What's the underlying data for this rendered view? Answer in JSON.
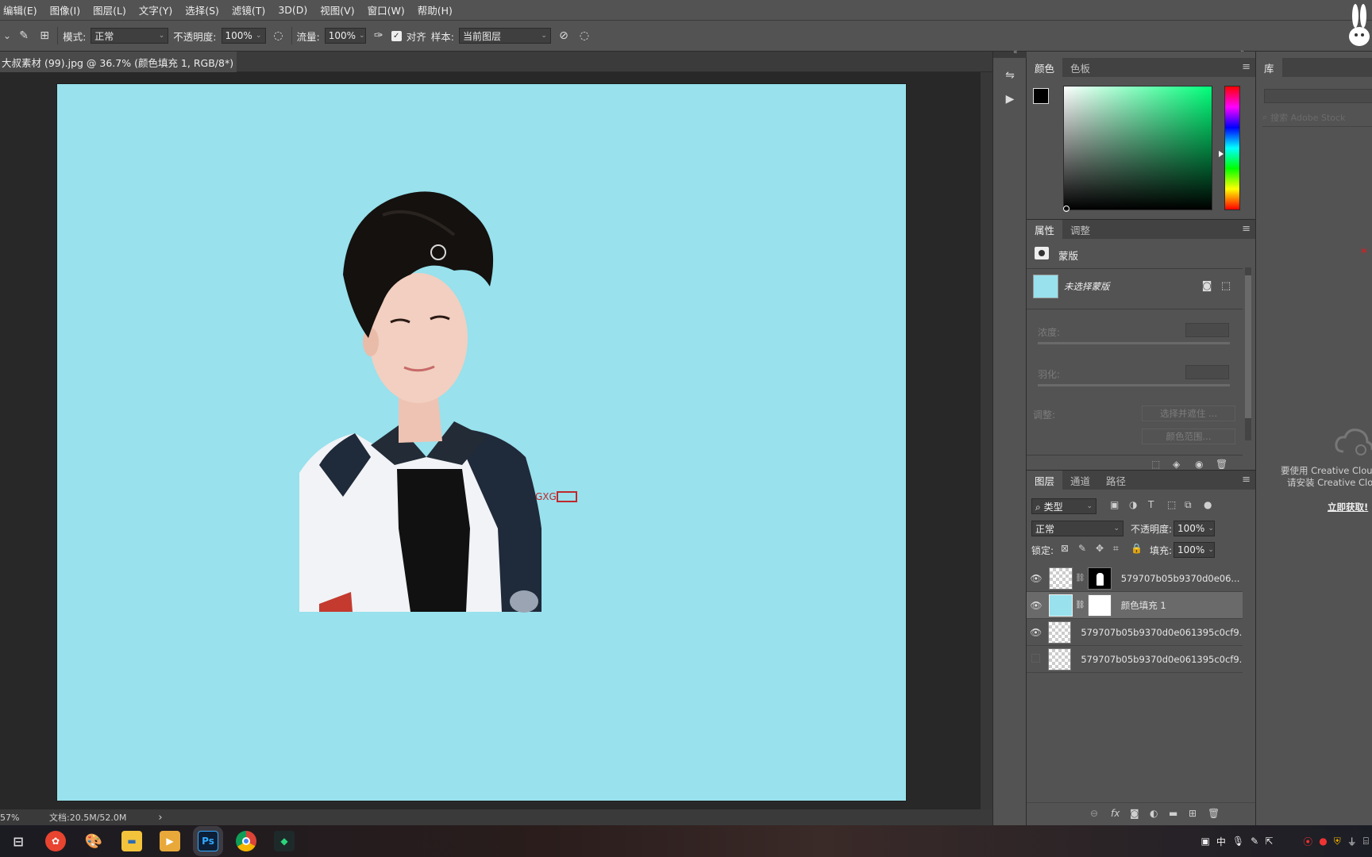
{
  "menu": [
    "编辑(E)",
    "图像(I)",
    "图层(L)",
    "文字(Y)",
    "选择(S)",
    "滤镜(T)",
    "3D(D)",
    "视图(V)",
    "窗口(W)",
    "帮助(H)"
  ],
  "options": {
    "mode_label": "模式:",
    "mode_value": "正常",
    "opacity_label": "不透明度:",
    "opacity_value": "100%",
    "flow_label": "流量:",
    "flow_value": "100%",
    "align_label": "对齐",
    "sample_label": "样本:",
    "sample_value": "当前图层"
  },
  "document": {
    "tab_title": "大叔素材 (99).jpg @ 36.7% (颜色填充 1, RGB/8*) *",
    "close": "×",
    "canvas_color": "#98e1ed"
  },
  "status": {
    "zoom": "57%",
    "doc_size": "文档:20.5M/52.0M",
    "arrow": "›"
  },
  "color_panel": {
    "tabs": [
      "颜色",
      "色板"
    ]
  },
  "properties_panel": {
    "tabs": [
      "属性",
      "调整"
    ],
    "mask_type": "蒙版",
    "mask_status": "未选择蒙版",
    "density_label": "浓度:",
    "feather_label": "羽化:",
    "adjust_label": "调整:",
    "select_mask_button": "选择并遮住 ...",
    "color_range_button": "颜色范围..."
  },
  "layers_panel": {
    "tabs": [
      "图层",
      "通道",
      "路径"
    ],
    "filter_label": "类型",
    "blend_mode": "正常",
    "opacity_label": "不透明度:",
    "opacity_value": "100%",
    "lock_label": "锁定:",
    "fill_label": "填充:",
    "fill_value": "100%",
    "layers": [
      {
        "name": "579707b05b9370d0e06...",
        "visible": true,
        "selected": false
      },
      {
        "name": "颜色填充 1",
        "visible": true,
        "selected": true
      },
      {
        "name": "579707b05b9370d0e061395c0cf9...",
        "visible": true,
        "selected": false
      },
      {
        "name": "579707b05b9370d0e061395c0cf9...",
        "visible": false,
        "selected": false
      }
    ]
  },
  "library_panel": {
    "tab": "库",
    "search_placeholder": "搜索 Adobe Stock",
    "cc_line1": "要使用 Creative Clou",
    "cc_line2": "请安装 Creative Clou",
    "install_link": "立即获取!"
  },
  "taskbar": {
    "apps": [
      "Ps"
    ],
    "ime": "中"
  }
}
